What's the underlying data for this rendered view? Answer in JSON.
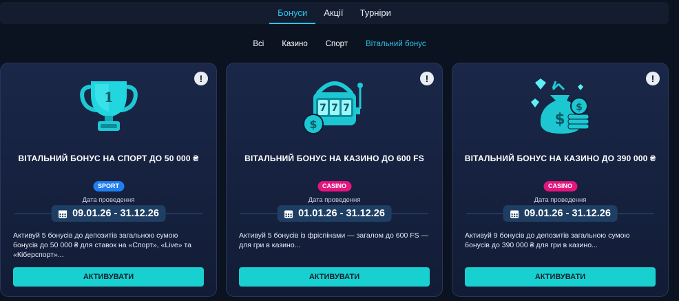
{
  "top_tabs": [
    "Бонуси",
    "Акції",
    "Турніри"
  ],
  "filters": [
    "Всі",
    "Казино",
    "Спорт",
    "Вітальний бонус"
  ],
  "cards": [
    {
      "title": "ВІТАЛЬНИЙ БОНУС НА СПОРТ ДО 50 000 ₴",
      "badge": "SPORT",
      "date_label": "Дата проведення",
      "dates": "09.01.26 - 31.12.26",
      "description": "Активуй 5 бонусів до депозитів загальною сумою бонусів до 50 000 ₴ для ставок на «Спорт», «Live» та «Кіберспорт»...",
      "button": "АКТИВУВАТИ"
    },
    {
      "title": "ВІТАЛЬНИЙ БОНУС НА КАЗИНО ДО 600 FS",
      "badge": "CASINO",
      "date_label": "Дата проведення",
      "dates": "01.01.26 - 31.12.26",
      "description": "Активуй 5 бонусів із фріспінами — загалом до 600 FS — для гри в казино...",
      "button": "АКТИВУВАТИ"
    },
    {
      "title": "ВІТАЛЬНИЙ БОНУС НА КАЗИНО ДО 390 000 ₴",
      "badge": "CASINO",
      "date_label": "Дата проведення",
      "dates": "09.01.26 - 31.12.26",
      "description": "Активуй 9 бонусів до депозитів загальною сумою бонусів до 390 000 ₴ для гри в казино...",
      "button": "АКТИВУВАТИ"
    }
  ],
  "colors": {
    "accent": "#2ec4e8",
    "button": "#18d0d0",
    "badge_sport": "#1e7ff0",
    "badge_casino": "#e5157e"
  },
  "icons": {
    "card_0": "trophy-icon",
    "card_1": "slot-machine-icon",
    "card_2": "money-bag-icon",
    "info": "info-icon",
    "date": "calendar-icon"
  }
}
